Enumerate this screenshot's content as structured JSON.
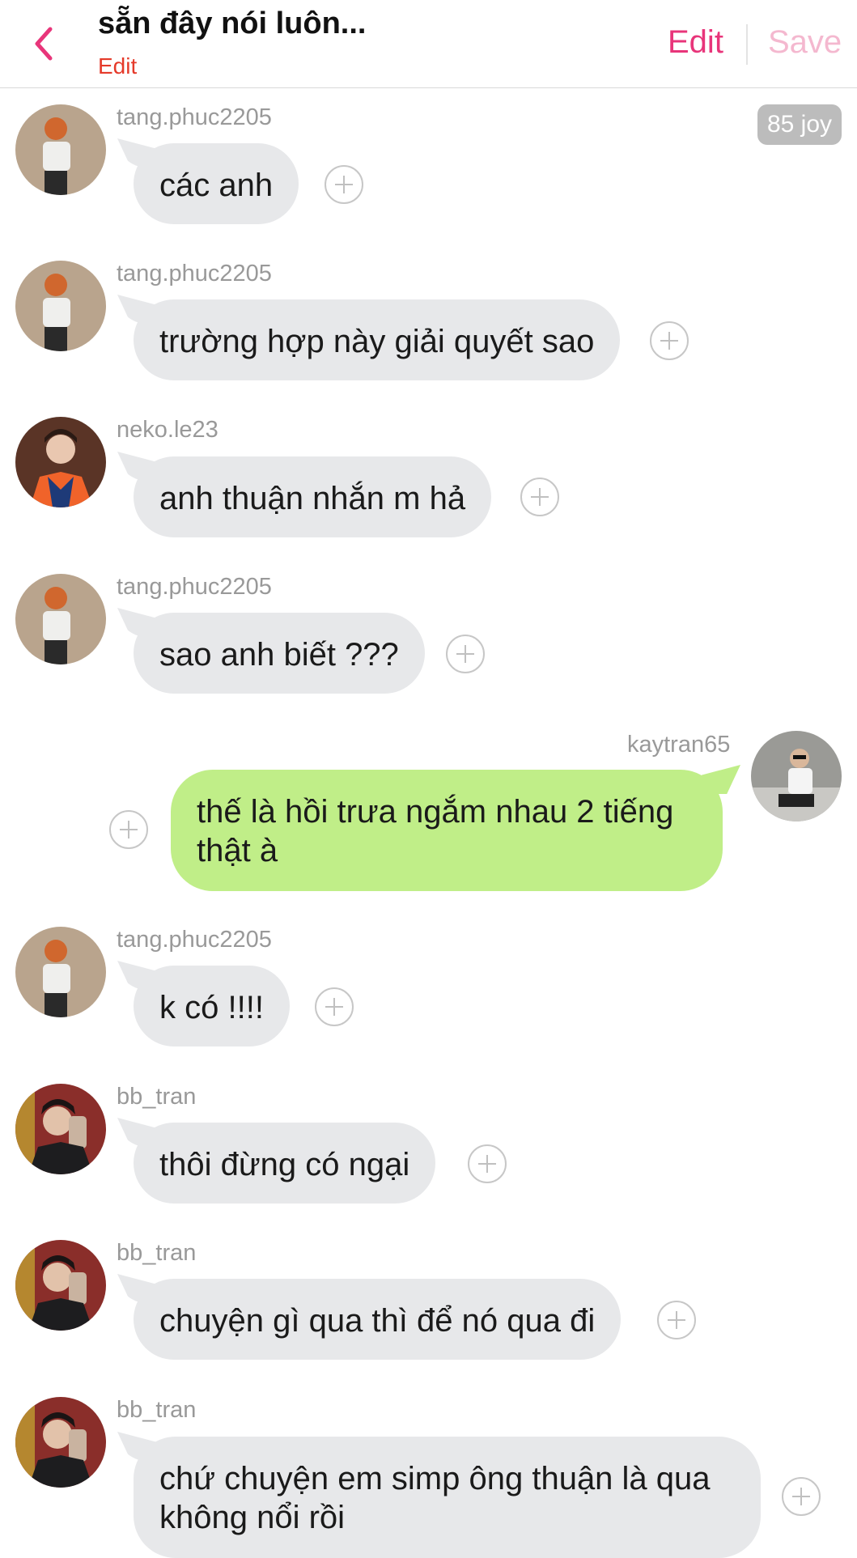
{
  "header": {
    "title": "sẵn đây nói luôn...",
    "sub_edit": "Edit",
    "edit_label": "Edit",
    "save_label": "Save",
    "accent": "#e8357a",
    "sub_accent": "#e53a2a"
  },
  "badge": {
    "text": "85 joy"
  },
  "messages": [
    {
      "user": "tang.phuc2205",
      "text": "các anh",
      "side": "in"
    },
    {
      "user": "tang.phuc2205",
      "text": "trường hợp này giải quyết sao",
      "side": "in"
    },
    {
      "user": "neko.le23",
      "text": "anh thuận nhắn m hả",
      "side": "in"
    },
    {
      "user": "tang.phuc2205",
      "text": "sao anh biết ???",
      "side": "in"
    },
    {
      "user": "kaytran65",
      "text": "thế là hồi trưa ngắm nhau 2 tiếng thật à",
      "side": "out"
    },
    {
      "user": "tang.phuc2205",
      "text": "k có !!!!",
      "side": "in"
    },
    {
      "user": "bb_tran",
      "text": "thôi đừng có ngại",
      "side": "in"
    },
    {
      "user": "bb_tran",
      "text": "chuyện gì qua thì để nó qua đi",
      "side": "in"
    },
    {
      "user": "bb_tran",
      "text": "chứ chuyện em simp ông thuận là qua không nổi rồi",
      "side": "in"
    }
  ],
  "colors": {
    "incoming_bubble": "#e7e8ea",
    "outgoing_bubble": "#c0ee88",
    "username": "#999999"
  }
}
